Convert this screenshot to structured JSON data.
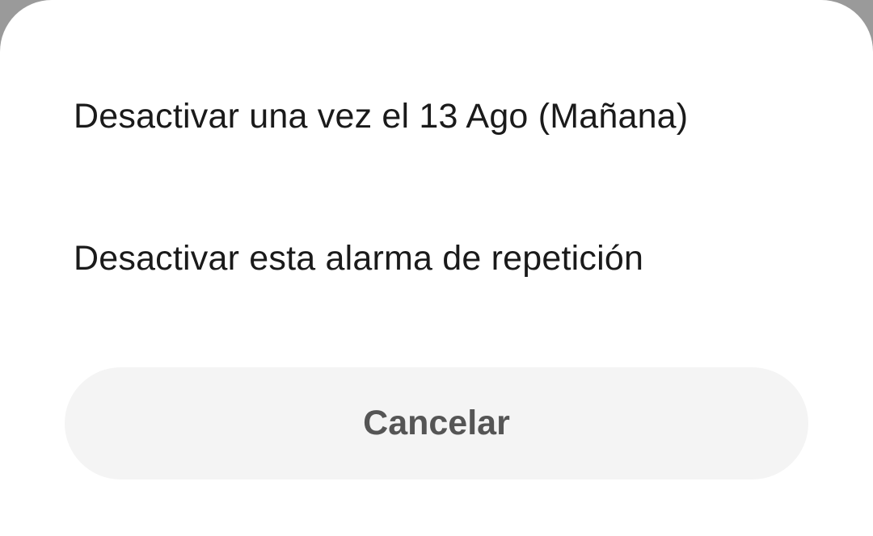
{
  "dialog": {
    "options": [
      {
        "label": "Desactivar una vez el 13 Ago (Mañana)"
      },
      {
        "label": "Desactivar esta alarma de repetición"
      }
    ],
    "cancel_label": "Cancelar"
  },
  "colors": {
    "sheet_background": "#ffffff",
    "scrim": "#9a9a9a",
    "option_text": "#1a1a1a",
    "cancel_background": "#f4f4f4",
    "cancel_text": "#555555"
  }
}
